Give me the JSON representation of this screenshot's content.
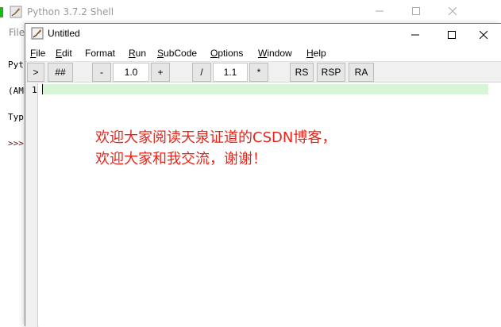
{
  "shell": {
    "title": "Python 3.7.2 Shell",
    "menu_label": "File",
    "lines": [
      "Pyt",
      "(AM",
      "Typ",
      ">>>"
    ],
    "controls": {
      "minimize": "—",
      "maximize": "☐",
      "close": "✕"
    }
  },
  "editor": {
    "title": "Untitled",
    "controls": {
      "minimize": "—",
      "maximize": "☐",
      "close": "✕"
    },
    "menu": [
      {
        "label": "File",
        "accel": "F",
        "rest": "ile"
      },
      {
        "label": "Edit",
        "accel": "E",
        "rest": "dit"
      },
      {
        "label": "Format",
        "accel": "",
        "rest": "Format"
      },
      {
        "label": "Run",
        "accel": "R",
        "rest": "un"
      },
      {
        "label": "SubCode",
        "accel": "S",
        "rest": "ubCode"
      },
      {
        "label": "Options",
        "accel": "O",
        "rest": "ptions"
      },
      {
        "label": "Window",
        "accel": "W",
        "rest": "indow"
      },
      {
        "label": "Help",
        "accel": "H",
        "rest": "elp"
      }
    ],
    "toolbar": {
      "run_label": ">",
      "comment_label": "##",
      "minus_label": "-",
      "zoom_value": "1.0",
      "plus_label": "+",
      "divide_label": "/",
      "factor_value": "1.1",
      "multiply_label": "*",
      "rs_label": "RS",
      "rsp_label": "RSP",
      "ra_label": "RA"
    },
    "line_number": "1",
    "overlay": {
      "line1": "欢迎大家阅读天泉证道的CSDN博客，",
      "line2": "欢迎大家和我交流，谢谢！",
      "color": "#e8241a"
    }
  }
}
